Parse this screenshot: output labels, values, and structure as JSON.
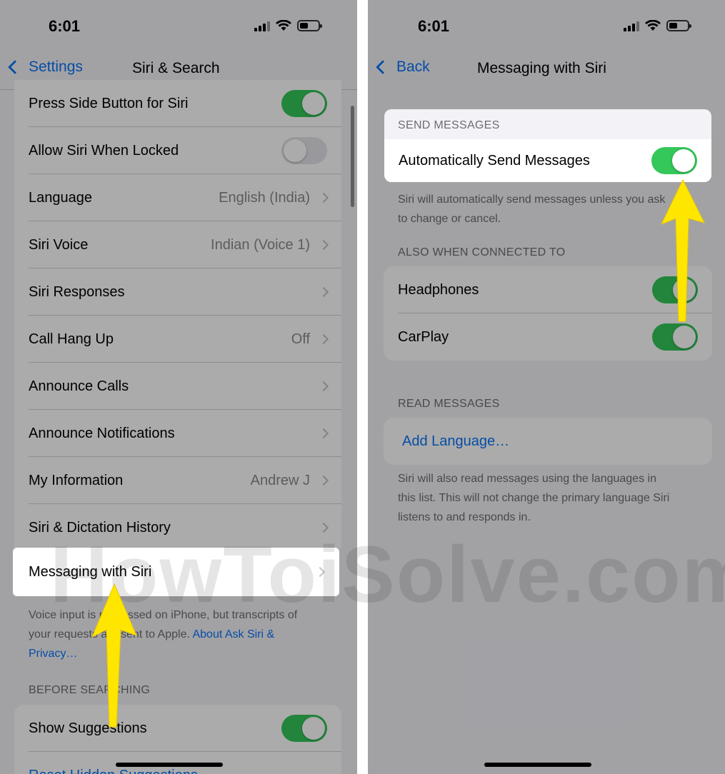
{
  "status_bar": {
    "time": "6:01"
  },
  "left": {
    "nav": {
      "back_label": "Settings",
      "title": "Siri & Search"
    },
    "rows": [
      {
        "label": "Press Side Button for Siri",
        "kind": "toggle",
        "on": true
      },
      {
        "label": "Allow Siri When Locked",
        "kind": "toggle",
        "on": false
      },
      {
        "label": "Language",
        "value": "English (India)",
        "kind": "nav"
      },
      {
        "label": "Siri Voice",
        "value": "Indian (Voice 1)",
        "kind": "nav"
      },
      {
        "label": "Siri Responses",
        "value": "",
        "kind": "nav"
      },
      {
        "label": "Call Hang Up",
        "value": "Off",
        "kind": "nav"
      },
      {
        "label": "Announce Calls",
        "value": "",
        "kind": "nav"
      },
      {
        "label": "Announce Notifications",
        "value": "",
        "kind": "nav"
      },
      {
        "label": "My Information",
        "value": "Andrew J",
        "kind": "nav"
      },
      {
        "label": "Siri & Dictation History",
        "value": "",
        "kind": "nav"
      }
    ],
    "highlight_row": {
      "label": "Messaging with Siri"
    },
    "footnote": {
      "line1": "Voice input is processed on iPhone, but transcripts of",
      "line2_prefix": "your requests are sent to Apple.",
      "line2_link": "About Ask Siri &",
      "line3_link": "Privacy…"
    },
    "section_before_searching": "BEFORE SEARCHING",
    "show_suggestions": {
      "label": "Show Suggestions",
      "on": true
    },
    "reset_hidden": "Reset Hidden Suggestions"
  },
  "right": {
    "nav": {
      "back_label": "Back",
      "title": "Messaging with Siri"
    },
    "section_send": "SEND MESSAGES",
    "auto_send": {
      "label": "Automatically Send Messages",
      "on": true
    },
    "auto_send_note": {
      "line1": "Siri will automatically send messages unless you ask",
      "line2": "to change or cancel."
    },
    "section_also": "ALSO WHEN CONNECTED TO",
    "connected": [
      {
        "label": "Headphones",
        "on": true
      },
      {
        "label": "CarPlay",
        "on": true
      }
    ],
    "section_read": "READ MESSAGES",
    "add_language": "Add Language…",
    "read_note": {
      "line1": "Siri will also read messages using the languages in",
      "line2": "this list. This will not change the primary language Siri",
      "line3": "listens to and responds in."
    }
  },
  "watermark": "HowToiSolve.com",
  "colors": {
    "accent": "#0a74f7",
    "toggle_on": "#34c759",
    "arrow": "#ffe600"
  }
}
